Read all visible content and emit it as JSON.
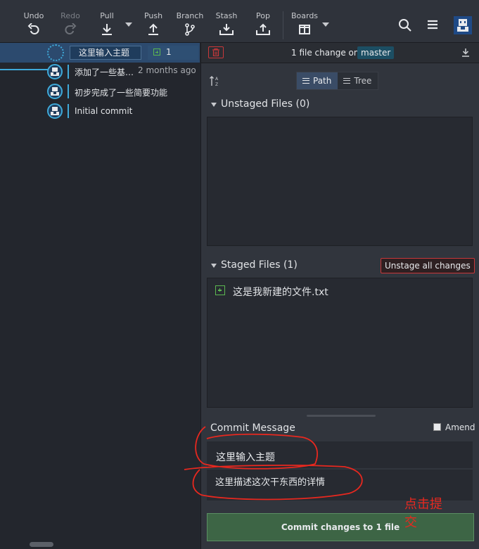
{
  "toolbar": {
    "undo": "Undo",
    "redo": "Redo",
    "pull": "Pull",
    "push": "Push",
    "branch": "Branch",
    "stash": "Stash",
    "pop": "Pop",
    "boards": "Boards"
  },
  "graph": {
    "wip_summary": "这里输入主题",
    "wip_file_count": "1",
    "commits": [
      {
        "message": "添加了一些基…",
        "date": "2 months ago"
      },
      {
        "message": "初步完成了一些简要功能",
        "date": ""
      },
      {
        "message": "Initial commit",
        "date": ""
      }
    ]
  },
  "panel": {
    "file_change_text": "1 file change on",
    "branch_name": "master",
    "view_path": "Path",
    "view_tree": "Tree",
    "unstaged_title": "Unstaged Files (0)",
    "staged_title": "Staged Files (1)",
    "unstage_all": "Unstage all changes",
    "staged_files": [
      "这是我新建的文件.txt"
    ],
    "commit_message_title": "Commit Message",
    "amend_label": "Amend",
    "summary_value": "这里输入主题",
    "description_value": "这里描述这次干东西的详情",
    "commit_button": "Commit changes to 1 file"
  },
  "annotation": {
    "note_text": "点击提交",
    "color": "#e8281f"
  },
  "colors": {
    "accent": "#3fa9d8",
    "danger": "#c9383a",
    "success": "#5bb750",
    "commit_button": "#3d6545"
  }
}
